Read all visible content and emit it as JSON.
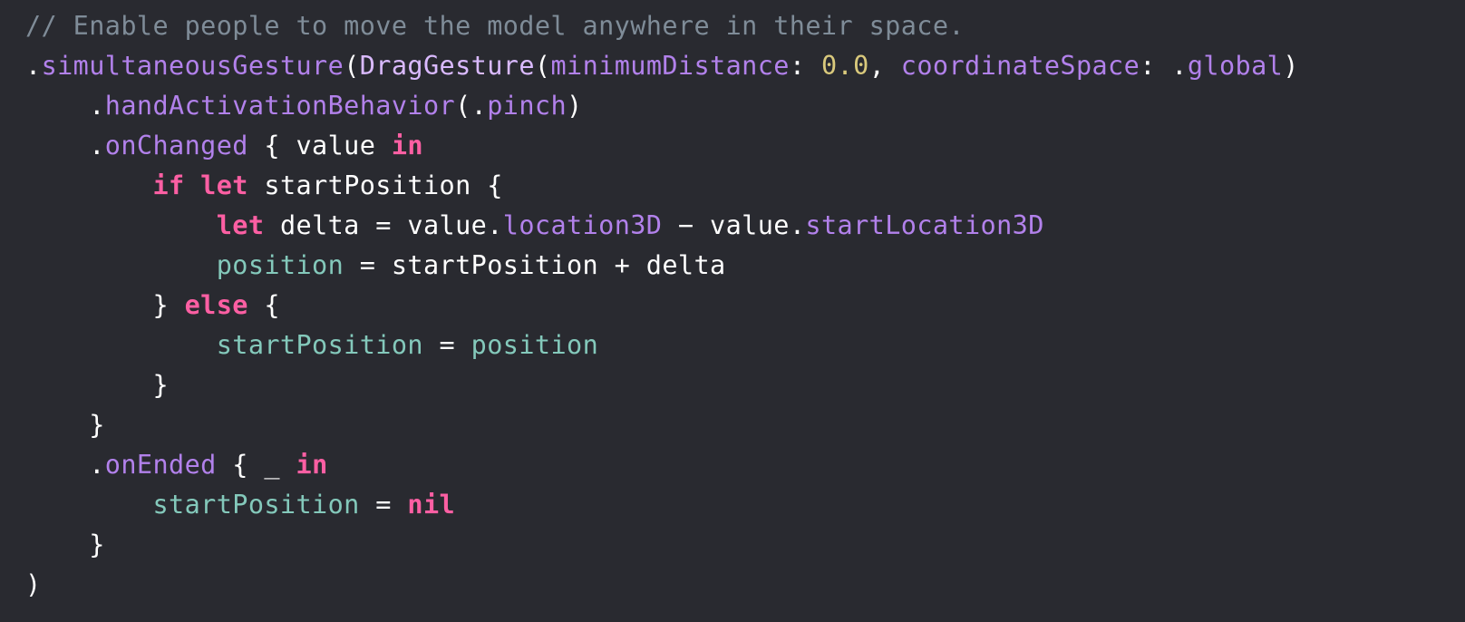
{
  "code": {
    "language": "swift",
    "lines": [
      {
        "indent": "",
        "tokens": [
          {
            "t": "// Enable people to move the model anywhere in their space.",
            "k": "comment"
          }
        ]
      },
      {
        "indent": "",
        "tokens": [
          {
            "t": ".",
            "k": "plain"
          },
          {
            "t": "simultaneousGesture",
            "k": "fn"
          },
          {
            "t": "(",
            "k": "plain"
          },
          {
            "t": "DragGesture",
            "k": "type"
          },
          {
            "t": "(",
            "k": "plain"
          },
          {
            "t": "minimumDistance",
            "k": "fn"
          },
          {
            "t": ": ",
            "k": "plain"
          },
          {
            "t": "0.0",
            "k": "num"
          },
          {
            "t": ", ",
            "k": "plain"
          },
          {
            "t": "coordinateSpace",
            "k": "fn"
          },
          {
            "t": ": .",
            "k": "plain"
          },
          {
            "t": "global",
            "k": "fn"
          },
          {
            "t": ")",
            "k": "plain"
          }
        ]
      },
      {
        "indent": "    ",
        "tokens": [
          {
            "t": ".",
            "k": "plain"
          },
          {
            "t": "handActivationBehavior",
            "k": "fn"
          },
          {
            "t": "(.",
            "k": "plain"
          },
          {
            "t": "pinch",
            "k": "fn"
          },
          {
            "t": ")",
            "k": "plain"
          }
        ]
      },
      {
        "indent": "    ",
        "tokens": [
          {
            "t": ".",
            "k": "plain"
          },
          {
            "t": "onChanged",
            "k": "fn"
          },
          {
            "t": " { value ",
            "k": "plain"
          },
          {
            "t": "in",
            "k": "kw"
          }
        ]
      },
      {
        "indent": "        ",
        "tokens": [
          {
            "t": "if",
            "k": "kw"
          },
          {
            "t": " ",
            "k": "plain"
          },
          {
            "t": "let",
            "k": "kw"
          },
          {
            "t": " startPosition {",
            "k": "plain"
          }
        ]
      },
      {
        "indent": "            ",
        "tokens": [
          {
            "t": "let",
            "k": "kw"
          },
          {
            "t": " delta = value.",
            "k": "plain"
          },
          {
            "t": "location3D",
            "k": "fn"
          },
          {
            "t": " − value.",
            "k": "plain"
          },
          {
            "t": "startLocation3D",
            "k": "fn"
          }
        ]
      },
      {
        "indent": "            ",
        "tokens": [
          {
            "t": "position",
            "k": "prop"
          },
          {
            "t": " = startPosition + delta",
            "k": "plain"
          }
        ]
      },
      {
        "indent": "        ",
        "tokens": [
          {
            "t": "} ",
            "k": "plain"
          },
          {
            "t": "else",
            "k": "kw"
          },
          {
            "t": " {",
            "k": "plain"
          }
        ]
      },
      {
        "indent": "            ",
        "tokens": [
          {
            "t": "startPosition",
            "k": "prop"
          },
          {
            "t": " = ",
            "k": "plain"
          },
          {
            "t": "position",
            "k": "prop"
          }
        ]
      },
      {
        "indent": "        ",
        "tokens": [
          {
            "t": "}",
            "k": "plain"
          }
        ]
      },
      {
        "indent": "    ",
        "tokens": [
          {
            "t": "}",
            "k": "plain"
          }
        ]
      },
      {
        "indent": "    ",
        "tokens": [
          {
            "t": ".",
            "k": "plain"
          },
          {
            "t": "onEnded",
            "k": "fn"
          },
          {
            "t": " { _ ",
            "k": "plain"
          },
          {
            "t": "in",
            "k": "kw"
          }
        ]
      },
      {
        "indent": "        ",
        "tokens": [
          {
            "t": "startPosition",
            "k": "prop"
          },
          {
            "t": " = ",
            "k": "plain"
          },
          {
            "t": "nil",
            "k": "kw"
          }
        ]
      },
      {
        "indent": "    ",
        "tokens": [
          {
            "t": "}",
            "k": "plain"
          }
        ]
      },
      {
        "indent": "",
        "tokens": [
          {
            "t": ")",
            "k": "plain"
          }
        ]
      }
    ]
  },
  "theme": {
    "background": "#292a30",
    "plain": "#ffffff",
    "comment": "#7f8c98",
    "keyword": "#fc5fa3",
    "function": "#b281eb",
    "type": "#dabaff",
    "number": "#d9c97c",
    "property": "#84c9bb"
  }
}
